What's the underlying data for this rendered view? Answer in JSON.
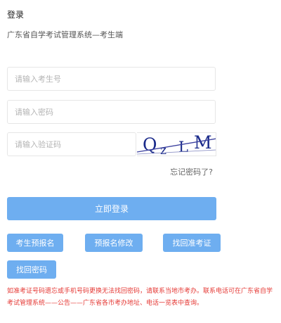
{
  "header": {
    "title": "登录",
    "subtitle": "广东省自学考试管理系统—考生端"
  },
  "form": {
    "username_placeholder": "请输入考生号",
    "password_placeholder": "请输入密码",
    "captcha_placeholder": "请输入验证码",
    "captcha_text": "QzLM",
    "forgot_label": "忘记密码了?",
    "login_label": "立即登录"
  },
  "actions": {
    "preregister_label": "考生预报名",
    "modify_label": "预报名修改",
    "retrieve_ticket_label": "找回准考证",
    "retrieve_password_label": "找回密码"
  },
  "notice": "如准考证号码遗忘或手机号码更换无法找回密码，请联系当地市考办。联系电话可在广东省自学考试管理系统——公告——广东省各市考办地址、电话一览表中查询。",
  "colors": {
    "primary_button": "#6eaef0",
    "notice_text": "#e53935",
    "captcha_text": "#1a2a8a"
  }
}
